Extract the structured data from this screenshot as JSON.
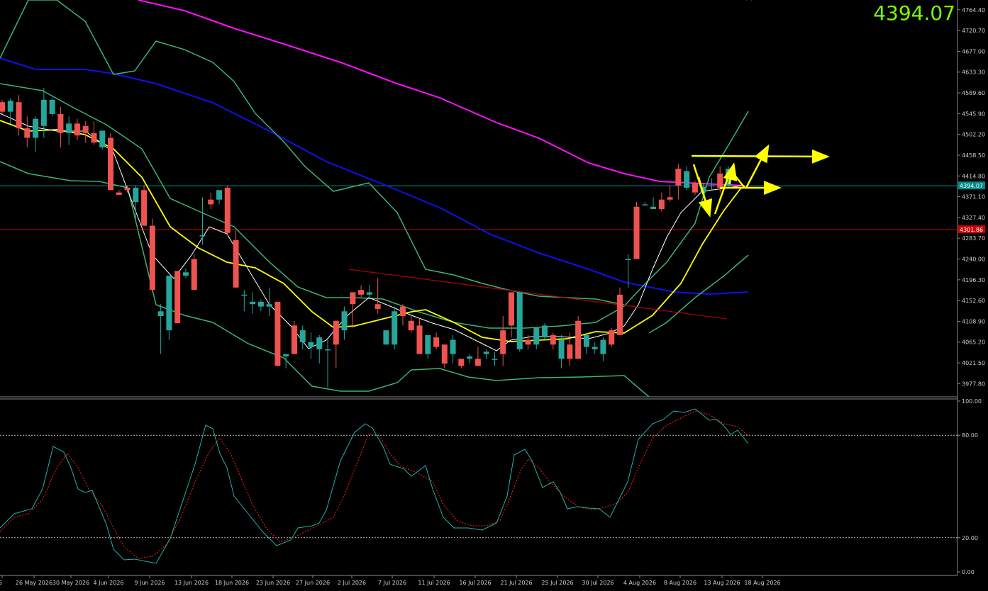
{
  "header": {
    "current_price": "4394.07"
  },
  "colors": {
    "background": "#000000",
    "bull": "#26a69a",
    "bear": "#ef5350",
    "ma_white": "#ffffff",
    "ma_yellow": "#ffff00",
    "ma_blue": "#1010ee",
    "ma_magenta": "#ff10ff",
    "bands": "#3cb371",
    "trendline": "#b00000",
    "level_cyan": "#008b8b",
    "level_red": "#cc0000",
    "annotations": "#ffff00",
    "stoch_main": "#20b2aa",
    "stoch_signal": "#ff2020",
    "axis_text": "#cccccc",
    "price_label": "#7CFC00"
  },
  "chart_data": {
    "type": "candlestick",
    "price_axis": {
      "ylim": [
        3950,
        4785
      ],
      "ticks": [
        "4764.40",
        "4720.70",
        "4677.00",
        "4633.30",
        "4589.60",
        "4545.90",
        "4502.20",
        "4458.50",
        "4414.80",
        "4371.10",
        "4327.40",
        "4283.70",
        "4240.00",
        "4196.30",
        "4152.60",
        "4108.90",
        "4065.20",
        "4021.50",
        "3977.80"
      ]
    },
    "date_labels": [
      "26",
      "26 May 2026",
      "30 May 2026",
      "4 Jun 2026",
      "9 Jun 2026",
      "13 Jun 2026",
      "18 Jun 2026",
      "23 Jun 2026",
      "27 Jun 2026",
      "2 Jul 2026",
      "7 Jul 2026",
      "11 Jul 2026",
      "16 Jul 2026",
      "21 Jul 2026",
      "25 Jul 2026",
      "30 Jul 2026",
      "4 Aug 2026",
      "8 Aug 2026",
      "13 Aug 2026",
      "18 Aug 2026"
    ],
    "candles": [
      [
        4570,
        4575,
        4545,
        4550
      ],
      [
        4550,
        4578,
        4525,
        4573
      ],
      [
        4570,
        4585,
        4500,
        4515
      ],
      [
        4515,
        4540,
        4475,
        4495
      ],
      [
        4495,
        4540,
        4465,
        4535
      ],
      [
        4520,
        4600,
        4495,
        4575
      ],
      [
        4545,
        4578,
        4540,
        4575
      ],
      [
        4545,
        4560,
        4475,
        4505
      ],
      [
        4505,
        4540,
        4480,
        4525
      ],
      [
        4525,
        4535,
        4490,
        4500
      ],
      [
        4520,
        4530,
        4485,
        4505
      ],
      [
        4505,
        4530,
        4480,
        4485
      ],
      [
        4475,
        4510,
        4470,
        4510
      ],
      [
        4495,
        4505,
        4385,
        4385
      ],
      [
        4380,
        4385,
        4375,
        4375
      ],
      [
        4390,
        4395,
        4380,
        4385
      ],
      [
        4360,
        4395,
        4325,
        4390
      ],
      [
        4385,
        4395,
        4310,
        4310
      ],
      [
        4310,
        4325,
        4170,
        4175
      ],
      [
        4120,
        4145,
        4040,
        4130
      ],
      [
        4090,
        4205,
        4070,
        4205
      ],
      [
        4215,
        4215,
        4110,
        4105
      ],
      [
        4205,
        4220,
        4200,
        4212
      ],
      [
        4240,
        4250,
        4175,
        4175
      ],
      [
        4290,
        4370,
        4270,
        4290
      ],
      [
        4365,
        4380,
        4345,
        4355
      ],
      [
        4365,
        4380,
        4355,
        4385
      ],
      [
        4390,
        4395,
        4290,
        4295
      ],
      [
        4280,
        4300,
        4180,
        4180
      ],
      [
        4165,
        4175,
        4130,
        4165
      ],
      [
        4145,
        4170,
        4125,
        4150
      ],
      [
        4140,
        4155,
        4130,
        4150
      ],
      [
        4140,
        4180,
        4120,
        4145
      ],
      [
        4150,
        4150,
        4015,
        4015
      ],
      [
        4035,
        4040,
        4010,
        4040
      ],
      [
        4100,
        4110,
        4040,
        4040
      ],
      [
        4065,
        4100,
        4050,
        4090
      ],
      [
        4055,
        4085,
        4030,
        4065
      ],
      [
        4050,
        4080,
        4020,
        4075
      ],
      [
        4050,
        4070,
        3970,
        4050
      ],
      [
        4110,
        4110,
        4010,
        4060
      ],
      [
        4090,
        4140,
        4070,
        4130
      ],
      [
        4170,
        4170,
        4095,
        4145
      ],
      [
        4175,
        4185,
        4160,
        4165
      ],
      [
        4165,
        4185,
        4160,
        4170
      ],
      [
        4145,
        4200,
        4125,
        4135
      ],
      [
        4060,
        4090,
        4060,
        4090
      ],
      [
        4060,
        4140,
        4050,
        4130
      ],
      [
        4140,
        4145,
        4100,
        4120
      ],
      [
        4110,
        4120,
        4085,
        4090
      ],
      [
        4100,
        4115,
        4040,
        4040
      ],
      [
        4040,
        4080,
        4030,
        4080
      ],
      [
        4075,
        4085,
        4050,
        4055
      ],
      [
        4060,
        4060,
        4010,
        4020
      ],
      [
        4040,
        4080,
        4020,
        4070
      ],
      [
        4030,
        4030,
        4010,
        4015
      ],
      [
        4030,
        4040,
        4020,
        4035
      ],
      [
        4030,
        4055,
        4015,
        4015
      ],
      [
        4040,
        4050,
        4030,
        4045
      ],
      [
        4030,
        4045,
        4015,
        4030
      ],
      [
        4090,
        4120,
        4015,
        4040
      ],
      [
        4170,
        4170,
        4075,
        4100
      ],
      [
        4050,
        4170,
        4045,
        4170
      ],
      [
        4070,
        4080,
        4050,
        4060
      ],
      [
        4060,
        4085,
        4050,
        4095
      ],
      [
        4075,
        4105,
        4070,
        4100
      ],
      [
        4080,
        4085,
        4050,
        4060
      ],
      [
        4030,
        4080,
        4010,
        4070
      ],
      [
        4060,
        4085,
        4015,
        4030
      ],
      [
        4110,
        4120,
        4030,
        4030
      ],
      [
        4055,
        4085,
        4040,
        4080
      ],
      [
        4050,
        4065,
        4040,
        4055
      ],
      [
        4040,
        4075,
        4025,
        4070
      ],
      [
        4090,
        4095,
        4055,
        4060
      ],
      [
        4165,
        4180,
        4080,
        4080
      ],
      [
        4240,
        4250,
        4180,
        4240
      ],
      [
        4350,
        4360,
        4240,
        4240
      ],
      [
        4355,
        4360,
        4355,
        4355
      ],
      [
        4345,
        4370,
        4345,
        4350
      ],
      [
        4365,
        4380,
        4340,
        4345
      ],
      [
        4370,
        4395,
        4360,
        4365
      ],
      [
        4430,
        4440,
        4365,
        4395
      ],
      [
        4390,
        4435,
        4385,
        4425
      ],
      [
        4400,
        4405,
        4375,
        4380
      ],
      [
        4380,
        4400,
        4370,
        4392
      ],
      [
        4395,
        4410,
        4385,
        4395
      ],
      [
        4420,
        4435,
        4380,
        4390
      ],
      [
        4395,
        4435,
        4390,
        4430
      ]
    ],
    "horizontal_levels": [
      4394.07,
      4301.86
    ],
    "level_labels": [
      "4394.07",
      "4301.86"
    ],
    "stochastic": {
      "ylim": [
        0,
        100
      ],
      "ticks": [
        "100.00",
        "80.00",
        "20.00",
        "0.00"
      ],
      "levels": [
        80,
        20
      ]
    }
  }
}
